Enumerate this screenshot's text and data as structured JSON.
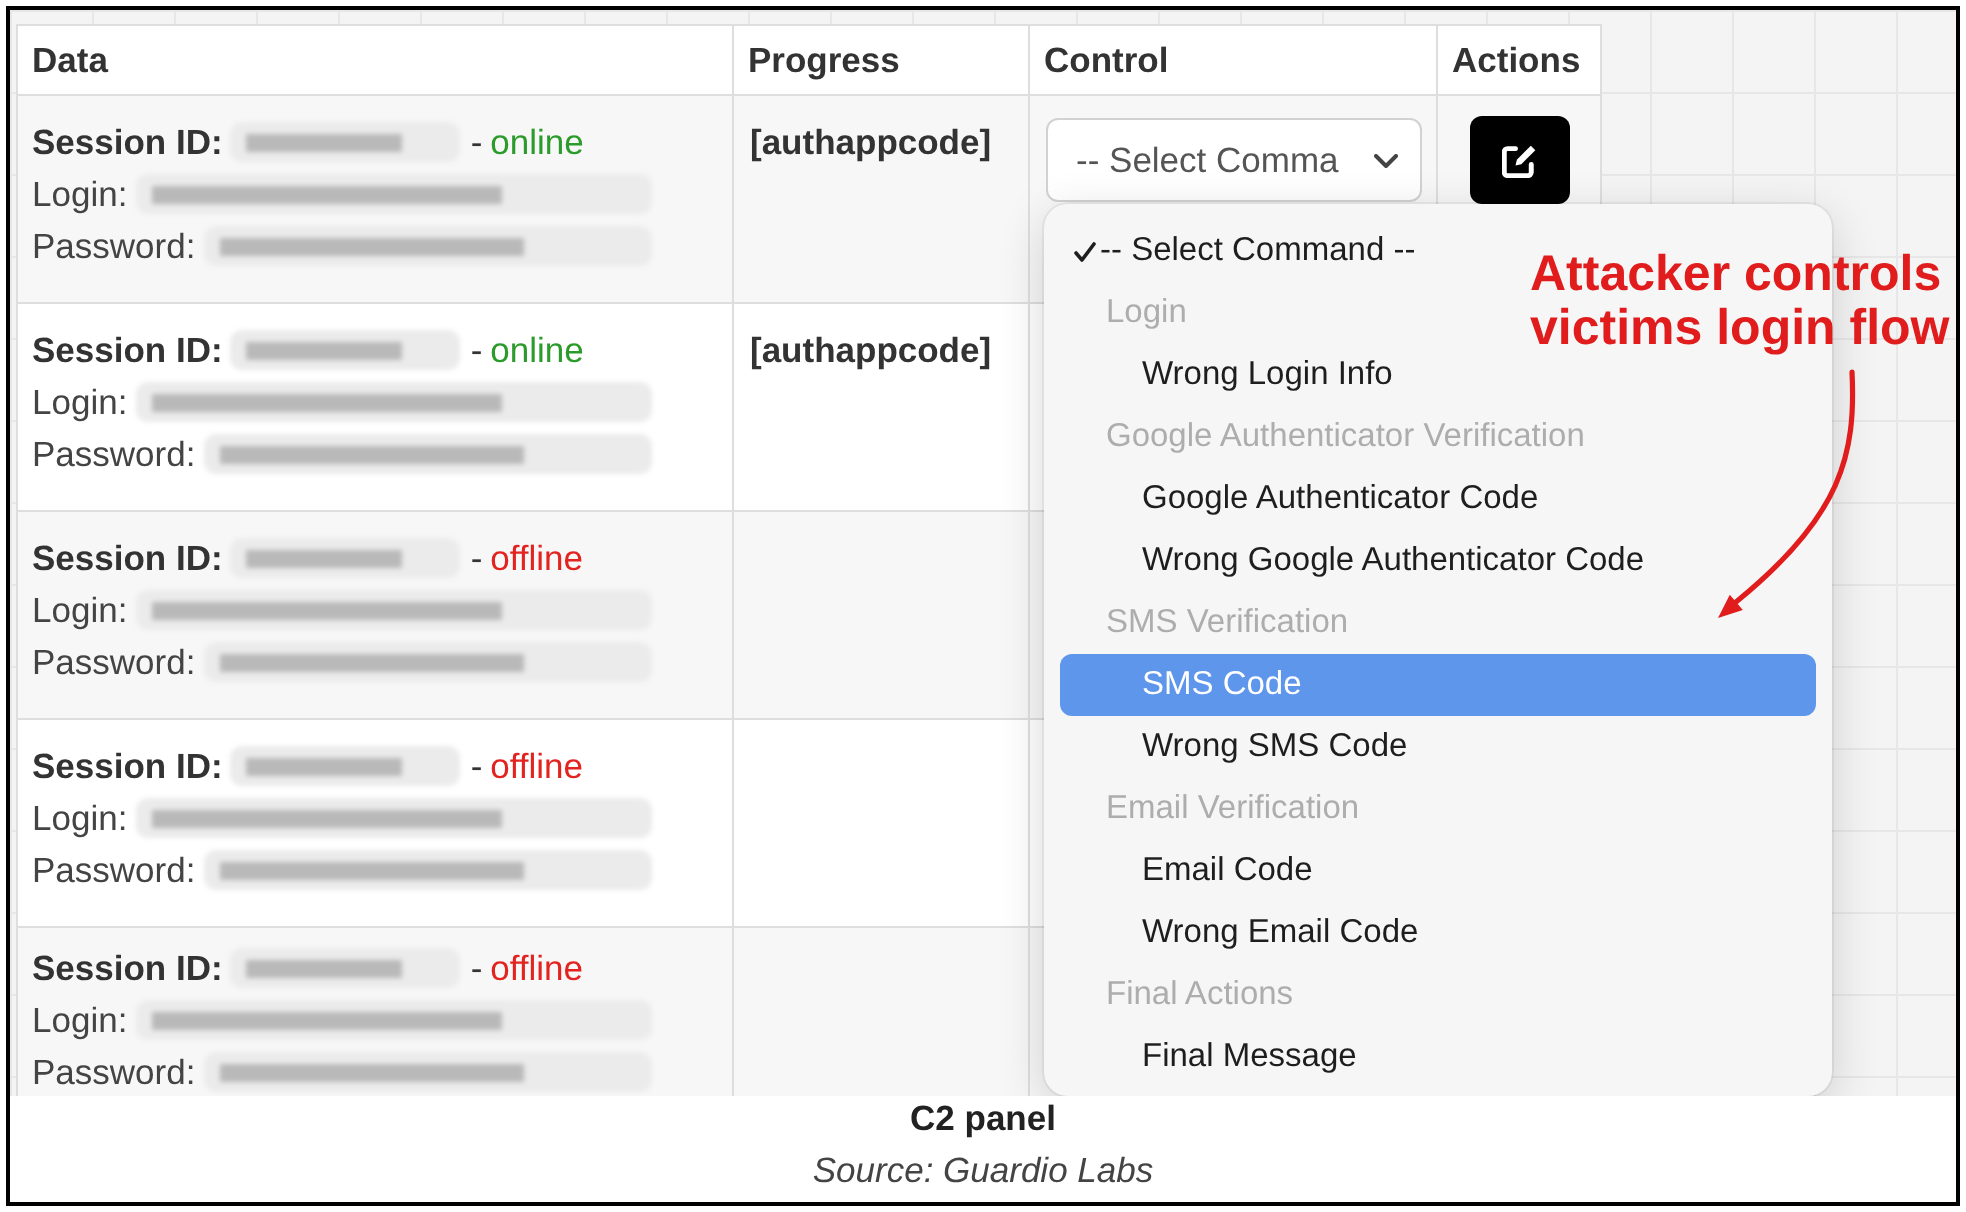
{
  "table": {
    "columns": [
      "Data",
      "Progress",
      "Control",
      "Actions"
    ],
    "rows": [
      {
        "session_id": {
          "label": "Session ID:",
          "redacted": true
        },
        "separator": "-",
        "status": {
          "text": "online",
          "color": "#2b9b2b"
        },
        "login": {
          "label": "Login:",
          "redacted": true
        },
        "password": {
          "label": "Password:",
          "redacted": true
        },
        "progress": "[authappcode]",
        "control": {
          "value": "-- Select Comma",
          "expanded": true
        },
        "actions": [
          {
            "kind": "edit"
          }
        ]
      },
      {
        "session_id": {
          "label": "Session ID:",
          "redacted": true
        },
        "separator": "-",
        "status": {
          "text": "online",
          "color": "#2b9b2b"
        },
        "login": {
          "label": "Login:",
          "redacted": true
        },
        "password": {
          "label": "Password:",
          "redacted": true
        },
        "progress": "[authappcode]"
      },
      {
        "session_id": {
          "label": "Session ID:",
          "redacted": true
        },
        "separator": "-",
        "status": {
          "text": "offline",
          "color": "#e32320"
        },
        "login": {
          "label": "Login:",
          "redacted": true
        },
        "password": {
          "label": "Password:",
          "redacted": true
        }
      },
      {
        "session_id": {
          "label": "Session ID:",
          "redacted": true
        },
        "separator": "-",
        "status": {
          "text": "offline",
          "color": "#e32320"
        },
        "login": {
          "label": "Login:",
          "redacted": true
        },
        "password": {
          "label": "Password:",
          "redacted": true
        }
      },
      {
        "session_id": {
          "label": "Session ID:",
          "redacted": true
        },
        "separator": "-",
        "status": {
          "text": "offline",
          "color": "#e32320"
        },
        "login": {
          "label": "Login:",
          "redacted": true
        },
        "password": {
          "label": "Password:",
          "redacted": true
        }
      }
    ]
  },
  "command_menu": {
    "items": [
      {
        "kind": "option",
        "label": "-- Select Command --",
        "checked": true,
        "selected": false
      },
      {
        "kind": "group",
        "label": "Login",
        "children": [
          {
            "kind": "option",
            "label": "Wrong Login Info",
            "checked": false,
            "selected": false
          }
        ]
      },
      {
        "kind": "group",
        "label": "Google Authenticator Verification",
        "children": [
          {
            "kind": "option",
            "label": "Google Authenticator Code",
            "checked": false,
            "selected": false
          },
          {
            "kind": "option",
            "label": "Wrong Google Authenticator Code",
            "checked": false,
            "selected": false
          }
        ]
      },
      {
        "kind": "group",
        "label": "SMS Verification",
        "children": [
          {
            "kind": "option",
            "label": "SMS Code",
            "checked": false,
            "selected": true
          },
          {
            "kind": "option",
            "label": "Wrong SMS Code",
            "checked": false,
            "selected": false
          }
        ]
      },
      {
        "kind": "group",
        "label": "Email Verification",
        "children": [
          {
            "kind": "option",
            "label": "Email Code",
            "checked": false,
            "selected": false
          },
          {
            "kind": "option",
            "label": "Wrong Email Code",
            "checked": false,
            "selected": false
          }
        ]
      },
      {
        "kind": "group",
        "label": "Final Actions",
        "children": [
          {
            "kind": "option",
            "label": "Final Message",
            "checked": false,
            "selected": false
          }
        ]
      }
    ]
  },
  "annotation": {
    "lines": [
      "Attacker controls",
      "victims login flow"
    ],
    "arrow": true
  },
  "caption": {
    "title": "C2 panel",
    "source": "Source: Guardio Labs"
  }
}
